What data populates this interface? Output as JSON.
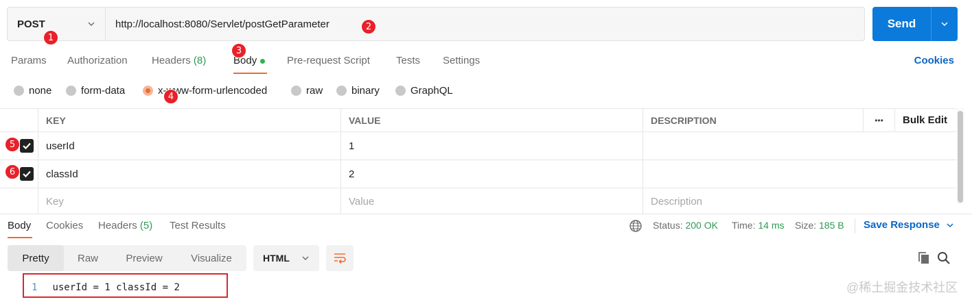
{
  "request": {
    "method": "POST",
    "url": "http://localhost:8080/Servlet/postGetParameter",
    "send_label": "Send"
  },
  "tabs": [
    {
      "label": "Params"
    },
    {
      "label": "Authorization"
    },
    {
      "label": "Headers",
      "count": "(8)"
    },
    {
      "label": "Body",
      "active": true
    },
    {
      "label": "Pre-request Script"
    },
    {
      "label": "Tests"
    },
    {
      "label": "Settings"
    }
  ],
  "cookies_label": "Cookies",
  "body_types": [
    {
      "label": "none"
    },
    {
      "label": "form-data"
    },
    {
      "label": "x-www-form-urlencoded",
      "selected": true
    },
    {
      "label": "raw"
    },
    {
      "label": "binary"
    },
    {
      "label": "GraphQL"
    }
  ],
  "params_table": {
    "headers": {
      "key": "KEY",
      "value": "VALUE",
      "description": "DESCRIPTION",
      "more": "•••",
      "bulk_edit": "Bulk Edit"
    },
    "rows": [
      {
        "key": "userId",
        "value": "1",
        "description": "",
        "checked": true
      },
      {
        "key": "classId",
        "value": "2",
        "description": "",
        "checked": true
      }
    ],
    "placeholder": {
      "key": "Key",
      "value": "Value",
      "description": "Description"
    }
  },
  "response": {
    "tabs": [
      {
        "label": "Body",
        "active": true
      },
      {
        "label": "Cookies"
      },
      {
        "label": "Headers",
        "count": "(5)"
      },
      {
        "label": "Test Results"
      }
    ],
    "status_label": "Status:",
    "status_value": "200 OK",
    "time_label": "Time:",
    "time_value": "14 ms",
    "size_label": "Size:",
    "size_value": "185 B",
    "save_label": "Save Response",
    "views": [
      "Pretty",
      "Raw",
      "Preview",
      "Visualize"
    ],
    "format": "HTML",
    "code_line_number": "1",
    "code_text": "userId = 1 classId = 2"
  },
  "annotations": [
    "1",
    "2",
    "3",
    "4",
    "5",
    "6"
  ],
  "watermark": "@稀土掘金技术社区",
  "colors": {
    "accent": "#ef6c2f",
    "send": "#0b7adb",
    "link": "#0b66c3",
    "badge": "#e8212a",
    "ok": "#2f9a54"
  }
}
